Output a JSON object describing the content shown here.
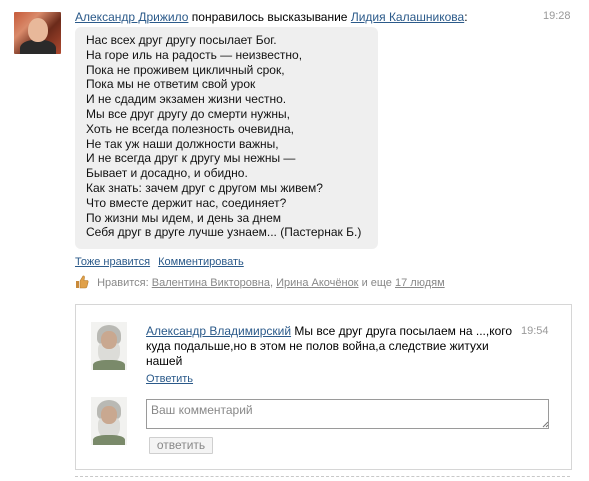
{
  "post": {
    "author": "Александр Дрижило",
    "action_text": "понравилось высказывание",
    "quoted_author": "Лидия Калашникова",
    "colon": ":",
    "time": "19:28",
    "poem_lines": [
      "Нас всех друг другу посылает Бог.",
      "На горе иль на радость — неизвестно,",
      "Пока не проживем цикличный срок,",
      "Пока мы не ответим свой урок",
      "И не сдадим экзамен жизни честно.",
      "Мы все друг другу до смерти нужны,",
      "Хоть не всегда полезность очевидна,",
      "Не так уж наши должности важны,",
      "И не всегда друг к другу мы нежны —",
      "Бывает и досадно, и обидно.",
      "Как знать: зачем друг с другом мы живем?",
      "Что вместе держит нас, соединяет?",
      "По жизни мы идем, и день за днем",
      "Себя друг в друге лучше узнаем... (Пастернак Б.)"
    ],
    "actions": {
      "like_too": "Тоже нравится",
      "comment": "Комментировать"
    },
    "likes": {
      "label": "Нравится:",
      "user1": "Валентина Викторовна",
      "sep": ",",
      "user2": "Ирина Акочёнок",
      "and_more": "и еще",
      "count_link": "17 людям"
    }
  },
  "comment": {
    "author": "Александр Владимирский",
    "text": "Мы все друг друга посылаем на ...,кого куда подальше,но в этом не полов война,а следствие житухи нашей",
    "time": "19:54",
    "reply": "Ответить"
  },
  "new_comment": {
    "placeholder": "Ваш комментарий",
    "submit": "ответить"
  }
}
